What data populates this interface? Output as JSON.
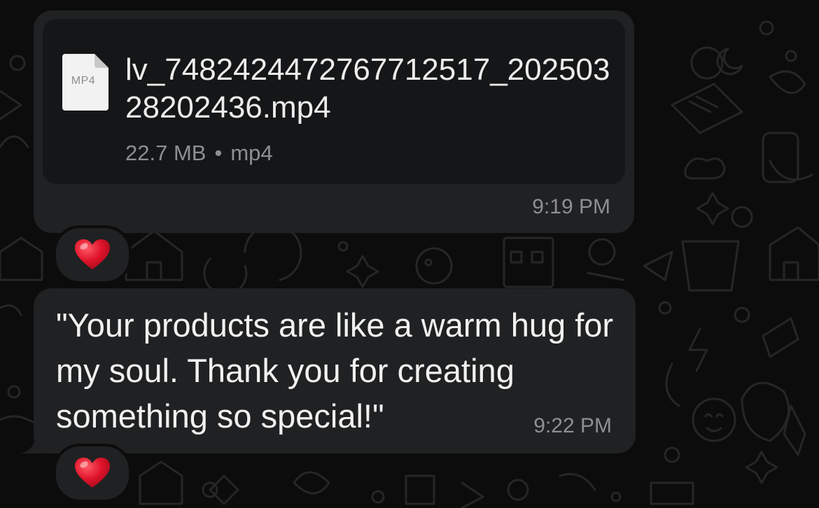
{
  "messages": [
    {
      "type": "file",
      "file": {
        "icon_label": "MP4",
        "icon": "document-icon",
        "name": "lv_7482424472767712517_20250328202436.mp4",
        "size": "22.7 MB",
        "separator": "•",
        "format": "mp4"
      },
      "time": "9:19 PM",
      "reaction": {
        "emoji": "heart-icon",
        "color": "#e0142a"
      }
    },
    {
      "type": "text",
      "text": "\"Your products are like a warm hug for my soul. Thank you for creating something so special!\"",
      "time": "9:22 PM",
      "reaction": {
        "emoji": "heart-icon",
        "color": "#e0142a"
      }
    }
  ],
  "colors": {
    "bubble": "#202122",
    "file_card": "#151617",
    "text": "#f1f1f1",
    "meta": "#8e8f90",
    "wallpaper": "#0c0c0c"
  }
}
